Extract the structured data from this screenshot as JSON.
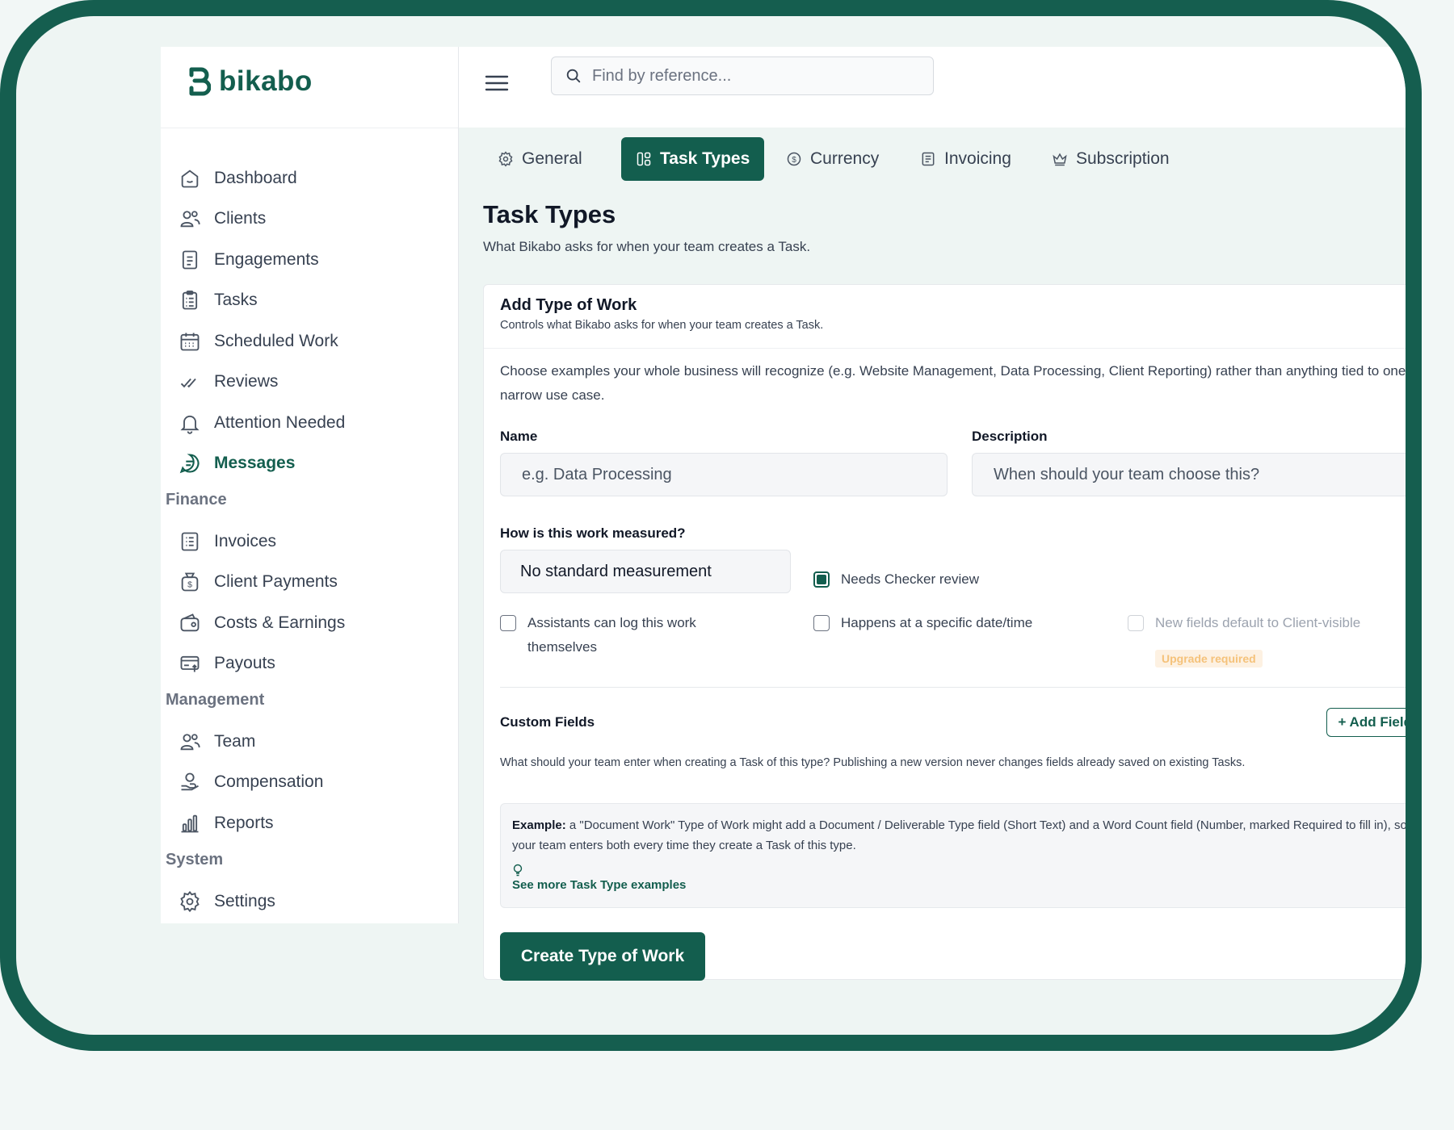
{
  "brand": {
    "name": "bikabo",
    "color": "#135e4e"
  },
  "search": {
    "placeholder": "Find by reference..."
  },
  "sidebar": {
    "items": [
      {
        "label": "Dashboard",
        "icon": "home-icon"
      },
      {
        "label": "Clients",
        "icon": "users-icon"
      },
      {
        "label": "Engagements",
        "icon": "document-icon"
      },
      {
        "label": "Tasks",
        "icon": "clipboard-list-icon"
      },
      {
        "label": "Scheduled Work",
        "icon": "calendar-icon"
      },
      {
        "label": "Reviews",
        "icon": "double-check-icon"
      },
      {
        "label": "Attention Needed",
        "icon": "bell-icon"
      },
      {
        "label": "Messages",
        "icon": "chat-icon",
        "active": true
      }
    ],
    "sections": {
      "finance": {
        "label": "Finance",
        "items": [
          {
            "label": "Invoices",
            "icon": "invoice-icon"
          },
          {
            "label": "Client Payments",
            "icon": "money-bag-icon"
          },
          {
            "label": "Costs & Earnings",
            "icon": "wallet-icon"
          },
          {
            "label": "Payouts",
            "icon": "card-upload-icon"
          }
        ]
      },
      "management": {
        "label": "Management",
        "items": [
          {
            "label": "Team",
            "icon": "users-icon"
          },
          {
            "label": "Compensation",
            "icon": "hand-coin-icon"
          },
          {
            "label": "Reports",
            "icon": "bar-chart-icon"
          }
        ]
      },
      "system": {
        "label": "System",
        "items": [
          {
            "label": "Settings",
            "icon": "gear-icon"
          }
        ]
      }
    }
  },
  "tabs": [
    {
      "label": "General",
      "icon": "gear-icon"
    },
    {
      "label": "Task Types",
      "icon": "layout-icon",
      "active": true
    },
    {
      "label": "Currency",
      "icon": "dollar-circle-icon"
    },
    {
      "label": "Invoicing",
      "icon": "invoice-icon"
    },
    {
      "label": "Subscription",
      "icon": "crown-icon"
    }
  ],
  "page": {
    "title": "Task Types",
    "subtitle": "What Bikabo asks for when your team creates a Task."
  },
  "card": {
    "title": "Add Type of Work",
    "subtitle": "Controls what Bikabo asks for when your team creates a Task.",
    "intro": "Choose examples your whole business will recognize (e.g. Website Management, Data Processing, Client Reporting) rather than anything tied to one narrow use case.",
    "name_label": "Name",
    "name_placeholder": "e.g. Data Processing",
    "description_label": "Description",
    "description_placeholder": "When should your team choose this?",
    "measure_label": "How is this work measured?",
    "measure_value": "No standard measurement",
    "options": {
      "needs_checker": {
        "label": "Needs Checker review",
        "checked": true
      },
      "assistants_log": {
        "label": "Assistants can log this work themselves",
        "checked": false
      },
      "specific_datetime": {
        "label": "Happens at a specific date/time",
        "checked": false
      },
      "client_visible": {
        "label": "New fields default to Client-visible",
        "checked": false,
        "disabled": true
      }
    },
    "upgrade_badge": "Upgrade required",
    "custom_fields_label": "Custom Fields",
    "add_field_label": "+ Add Field",
    "custom_fields_help": "What should your team enter when creating a Task of this type? Publishing a new version never changes fields already saved on existing Tasks.",
    "example_label": "Example:",
    "example_text": " a \"Document Work\" Type of Work might add a Document / Deliverable Type field (Short Text) and a Word Count field (Number, marked Required to fill in), so your team enters both every time they create a Task of this type.",
    "example_link": "See more Task Type examples",
    "create_button": "Create Type of Work"
  }
}
